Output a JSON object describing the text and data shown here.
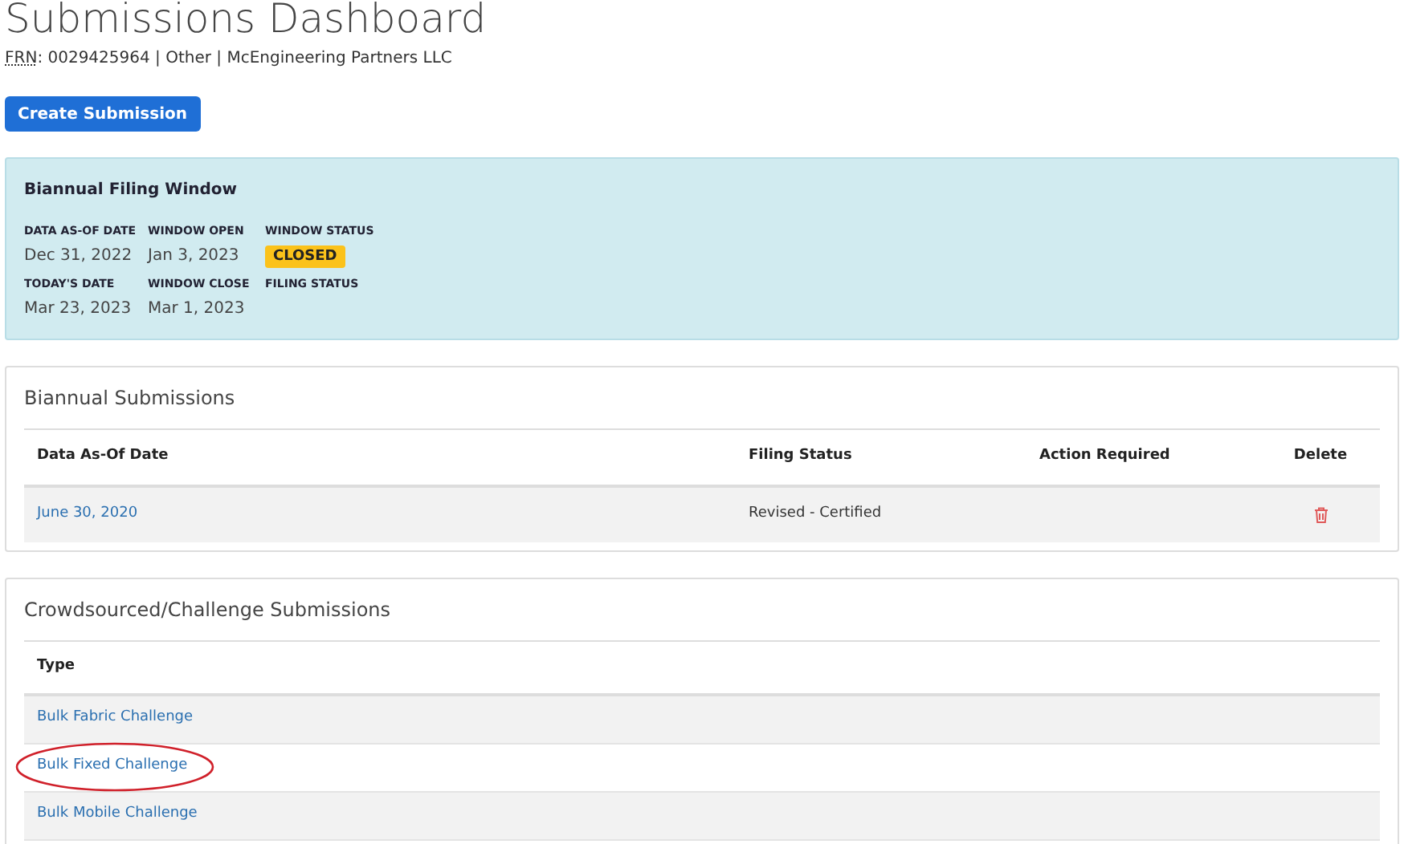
{
  "page": {
    "title": "Submissions Dashboard",
    "frn_label": "FRN",
    "frn_rest": ": 0029425964 | Other | McEngineering Partners LLC"
  },
  "create_button": "Create Submission",
  "filing_window": {
    "title": "Biannual Filing Window",
    "fields": [
      {
        "label": "DATA AS-OF DATE",
        "value": "Dec 31, 2022"
      },
      {
        "label": "WINDOW OPEN",
        "value": "Jan 3, 2023"
      },
      {
        "label": "WINDOW STATUS",
        "badge": "CLOSED"
      },
      {
        "label": "TODAY'S DATE",
        "value": "Mar 23, 2023"
      },
      {
        "label": "WINDOW CLOSE",
        "value": "Mar 1, 2023"
      },
      {
        "label": "FILING STATUS"
      }
    ]
  },
  "biannual": {
    "title": "Biannual Submissions",
    "columns": [
      "Data As-Of Date",
      "Filing Status",
      "Action Required",
      "Delete"
    ],
    "rows": [
      {
        "date": "June 30, 2020",
        "status": "Revised - Certified"
      }
    ]
  },
  "crowdsourced": {
    "title": "Crowdsourced/Challenge Submissions",
    "columns": [
      "Type"
    ],
    "rows": [
      {
        "type": "Bulk Fabric Challenge",
        "circled": false
      },
      {
        "type": "Bulk Fixed Challenge",
        "circled": true
      },
      {
        "type": "Bulk Mobile Challenge",
        "circled": false
      }
    ]
  }
}
